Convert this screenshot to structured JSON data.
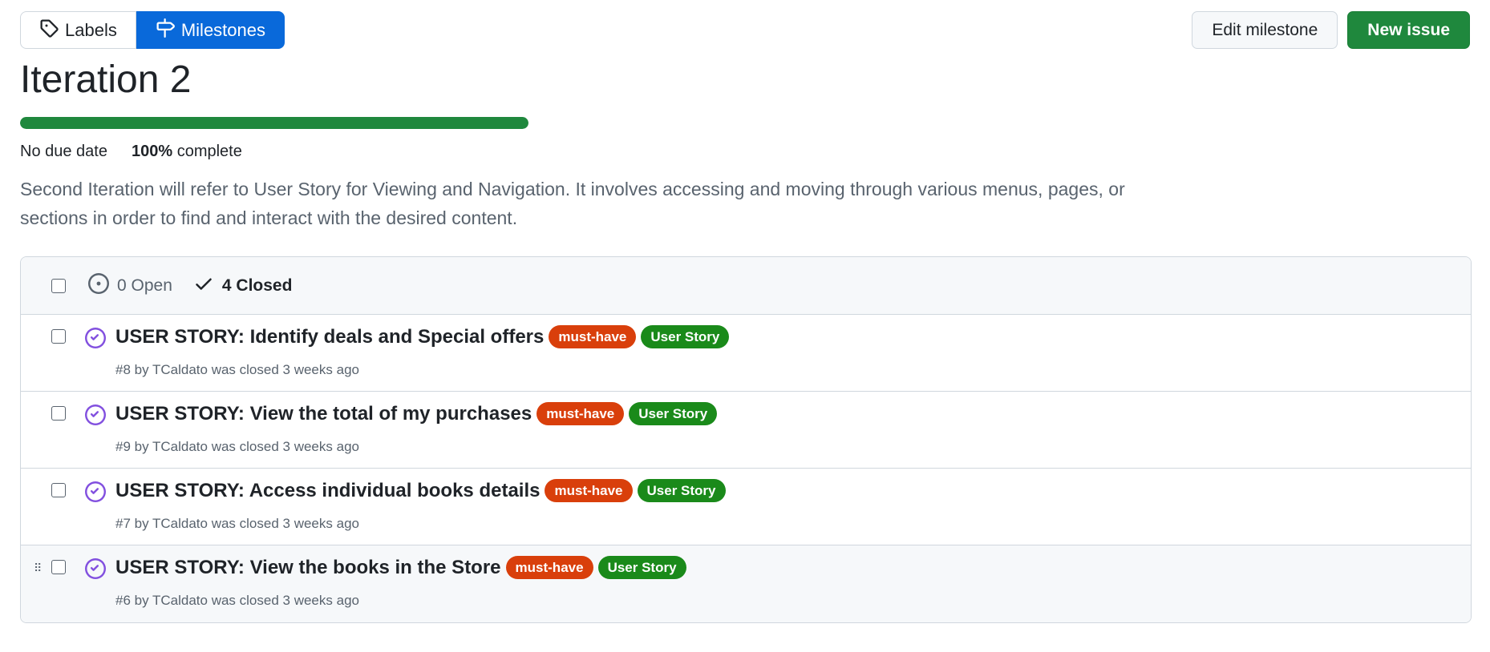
{
  "subnav": {
    "labels": "Labels",
    "milestones": "Milestones"
  },
  "actions": {
    "edit": "Edit milestone",
    "new_issue": "New issue"
  },
  "milestone": {
    "title": "Iteration 2",
    "progress_percent": 100,
    "due": "No due date",
    "percent_value": "100%",
    "percent_label": "complete",
    "description": "Second Iteration will refer to User Story for Viewing and Navigation. It involves accessing and moving through various menus, pages, or sections in order to find and interact with the desired content."
  },
  "issues_header": {
    "open": "0 Open",
    "closed": "4 Closed"
  },
  "issues": [
    {
      "title": "USER STORY: Identify deals and Special offers",
      "labels": [
        "must-have",
        "User Story"
      ],
      "meta": "#8 by TCaldato was closed 3 weeks ago"
    },
    {
      "title": "USER STORY: View the total of my purchases",
      "labels": [
        "must-have",
        "User Story"
      ],
      "meta": "#9 by TCaldato was closed 3 weeks ago"
    },
    {
      "title": "USER STORY: Access individual books details",
      "labels": [
        "must-have",
        "User Story"
      ],
      "meta": "#7 by TCaldato was closed 3 weeks ago"
    },
    {
      "title": "USER STORY: View the books in the Store",
      "labels": [
        "must-have",
        "User Story"
      ],
      "meta": "#6 by TCaldato was closed 3 weeks ago"
    }
  ],
  "colors": {
    "accent": "#0969da",
    "success": "#1f883d",
    "label_must_have": "#d93f0b",
    "label_user_story": "#1a8a1a",
    "closed_icon": "#8250df"
  }
}
